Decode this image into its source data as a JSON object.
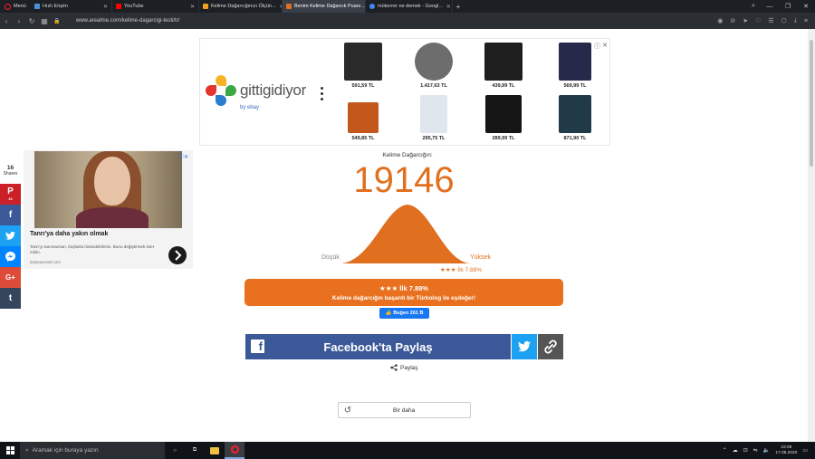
{
  "browser": {
    "menu_label": "Menü",
    "tabs": [
      {
        "title": "Hızlı Erişim",
        "active": false,
        "favicon_color": "#4a90d9"
      },
      {
        "title": "YouTube",
        "active": false,
        "favicon_color": "#ff0000"
      },
      {
        "title": "Kelime Dağarcığınızı Ölçün…",
        "active": false,
        "favicon_color": "#f0a020"
      },
      {
        "title": "Benim Kelime Dağarcık Puanı…",
        "active": true,
        "favicon_color": "#e07020"
      },
      {
        "title": "mükerrer ne demek - Googl…",
        "active": false,
        "favicon_color": "#4285f4"
      }
    ],
    "url": "www.arealme.com/kelime-dagarcigi-testi/tr/"
  },
  "ad_banner": {
    "brand": "gittigidiyor",
    "sub_brand": "by ebay",
    "products": [
      {
        "price": "591,59 TL",
        "color": "#2a2a2a"
      },
      {
        "price": "1.417,63 TL",
        "color": "#6d6d6d"
      },
      {
        "price": "439,99 TL",
        "color": "#1e1e1e"
      },
      {
        "price": "569,99 TL",
        "color": "#262a4a"
      },
      {
        "price": "549,85 TL",
        "color": "#c4581c"
      },
      {
        "price": "295,75 TL",
        "color": "#dfe6ee"
      },
      {
        "price": "289,99 TL",
        "color": "#151515"
      },
      {
        "price": "871,90 TL",
        "color": "#203a48"
      }
    ]
  },
  "social": {
    "shares_count": "16",
    "shares_label": "Shares",
    "pinterest_count": "16",
    "buttons": [
      {
        "name": "pinterest",
        "glyph": "P",
        "color": "#cb2027"
      },
      {
        "name": "facebook",
        "glyph": "f",
        "color": "#3b5998"
      },
      {
        "name": "twitter",
        "glyph": "t",
        "color": "#1da1f2"
      },
      {
        "name": "messenger",
        "glyph": "m",
        "color": "#0084ff"
      },
      {
        "name": "google-plus",
        "glyph": "G+",
        "color": "#dd4b39"
      },
      {
        "name": "tumblr",
        "glyph": "t",
        "color": "#35465c"
      }
    ]
  },
  "side_ad": {
    "title": "Tanrı'ya daha yakın olmak",
    "description": "Tanrı'yı tanımazsan, boşlukla hissedebilirsin. Bunu değiştirmek ister misin.",
    "source": "kampuseveli.com"
  },
  "result": {
    "label": "Kelime Dağarcığın:",
    "score": "19146",
    "low_label": "Düşük",
    "high_label": "Yüksek",
    "percentile_label": "★★★ İlk 7.88%",
    "banner_line1": "★★★ İlk 7.88%",
    "banner_line2": "Kelime dağarcığın başarılı bir Türkolog ile eşdeğer!",
    "like_label": "Beğen 261 B",
    "facebook_share": "Facebook'ta Paylaş",
    "share_label": "Paylaş",
    "retry_label": "Bir daha",
    "accent_color": "#e07020"
  },
  "taskbar": {
    "search_placeholder": "Aramak için buraya yazın",
    "time": "23:09",
    "date": "17.08.2020"
  }
}
